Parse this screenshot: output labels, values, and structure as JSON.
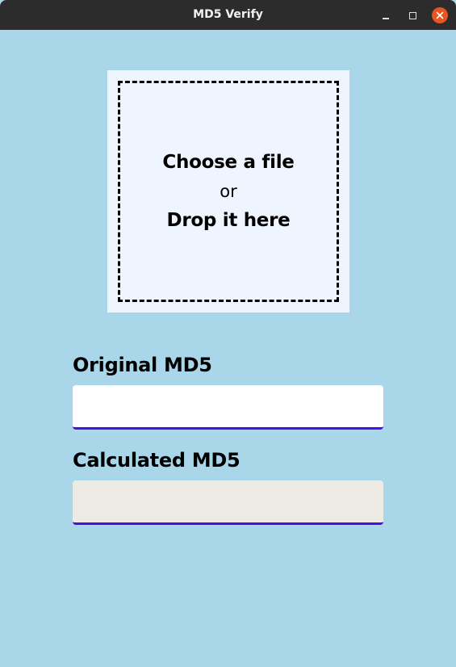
{
  "window": {
    "title": "MD5 Verify",
    "controls": [
      "minimize-icon",
      "maximize-icon",
      "close-icon"
    ]
  },
  "dropzone": {
    "line1": "Choose a file",
    "line2": "or",
    "line3": "Drop it here"
  },
  "original": {
    "label": "Original MD5",
    "value": ""
  },
  "calculated": {
    "label": "Calculated MD5",
    "value": ""
  },
  "colors": {
    "background": "#a9d6e9",
    "titlebar": "#2c2c2c",
    "close_button": "#e95420",
    "dropzone": "#eef5ff",
    "field_accent": "#4a0fe0",
    "readonly_field": "#ebebe4"
  }
}
